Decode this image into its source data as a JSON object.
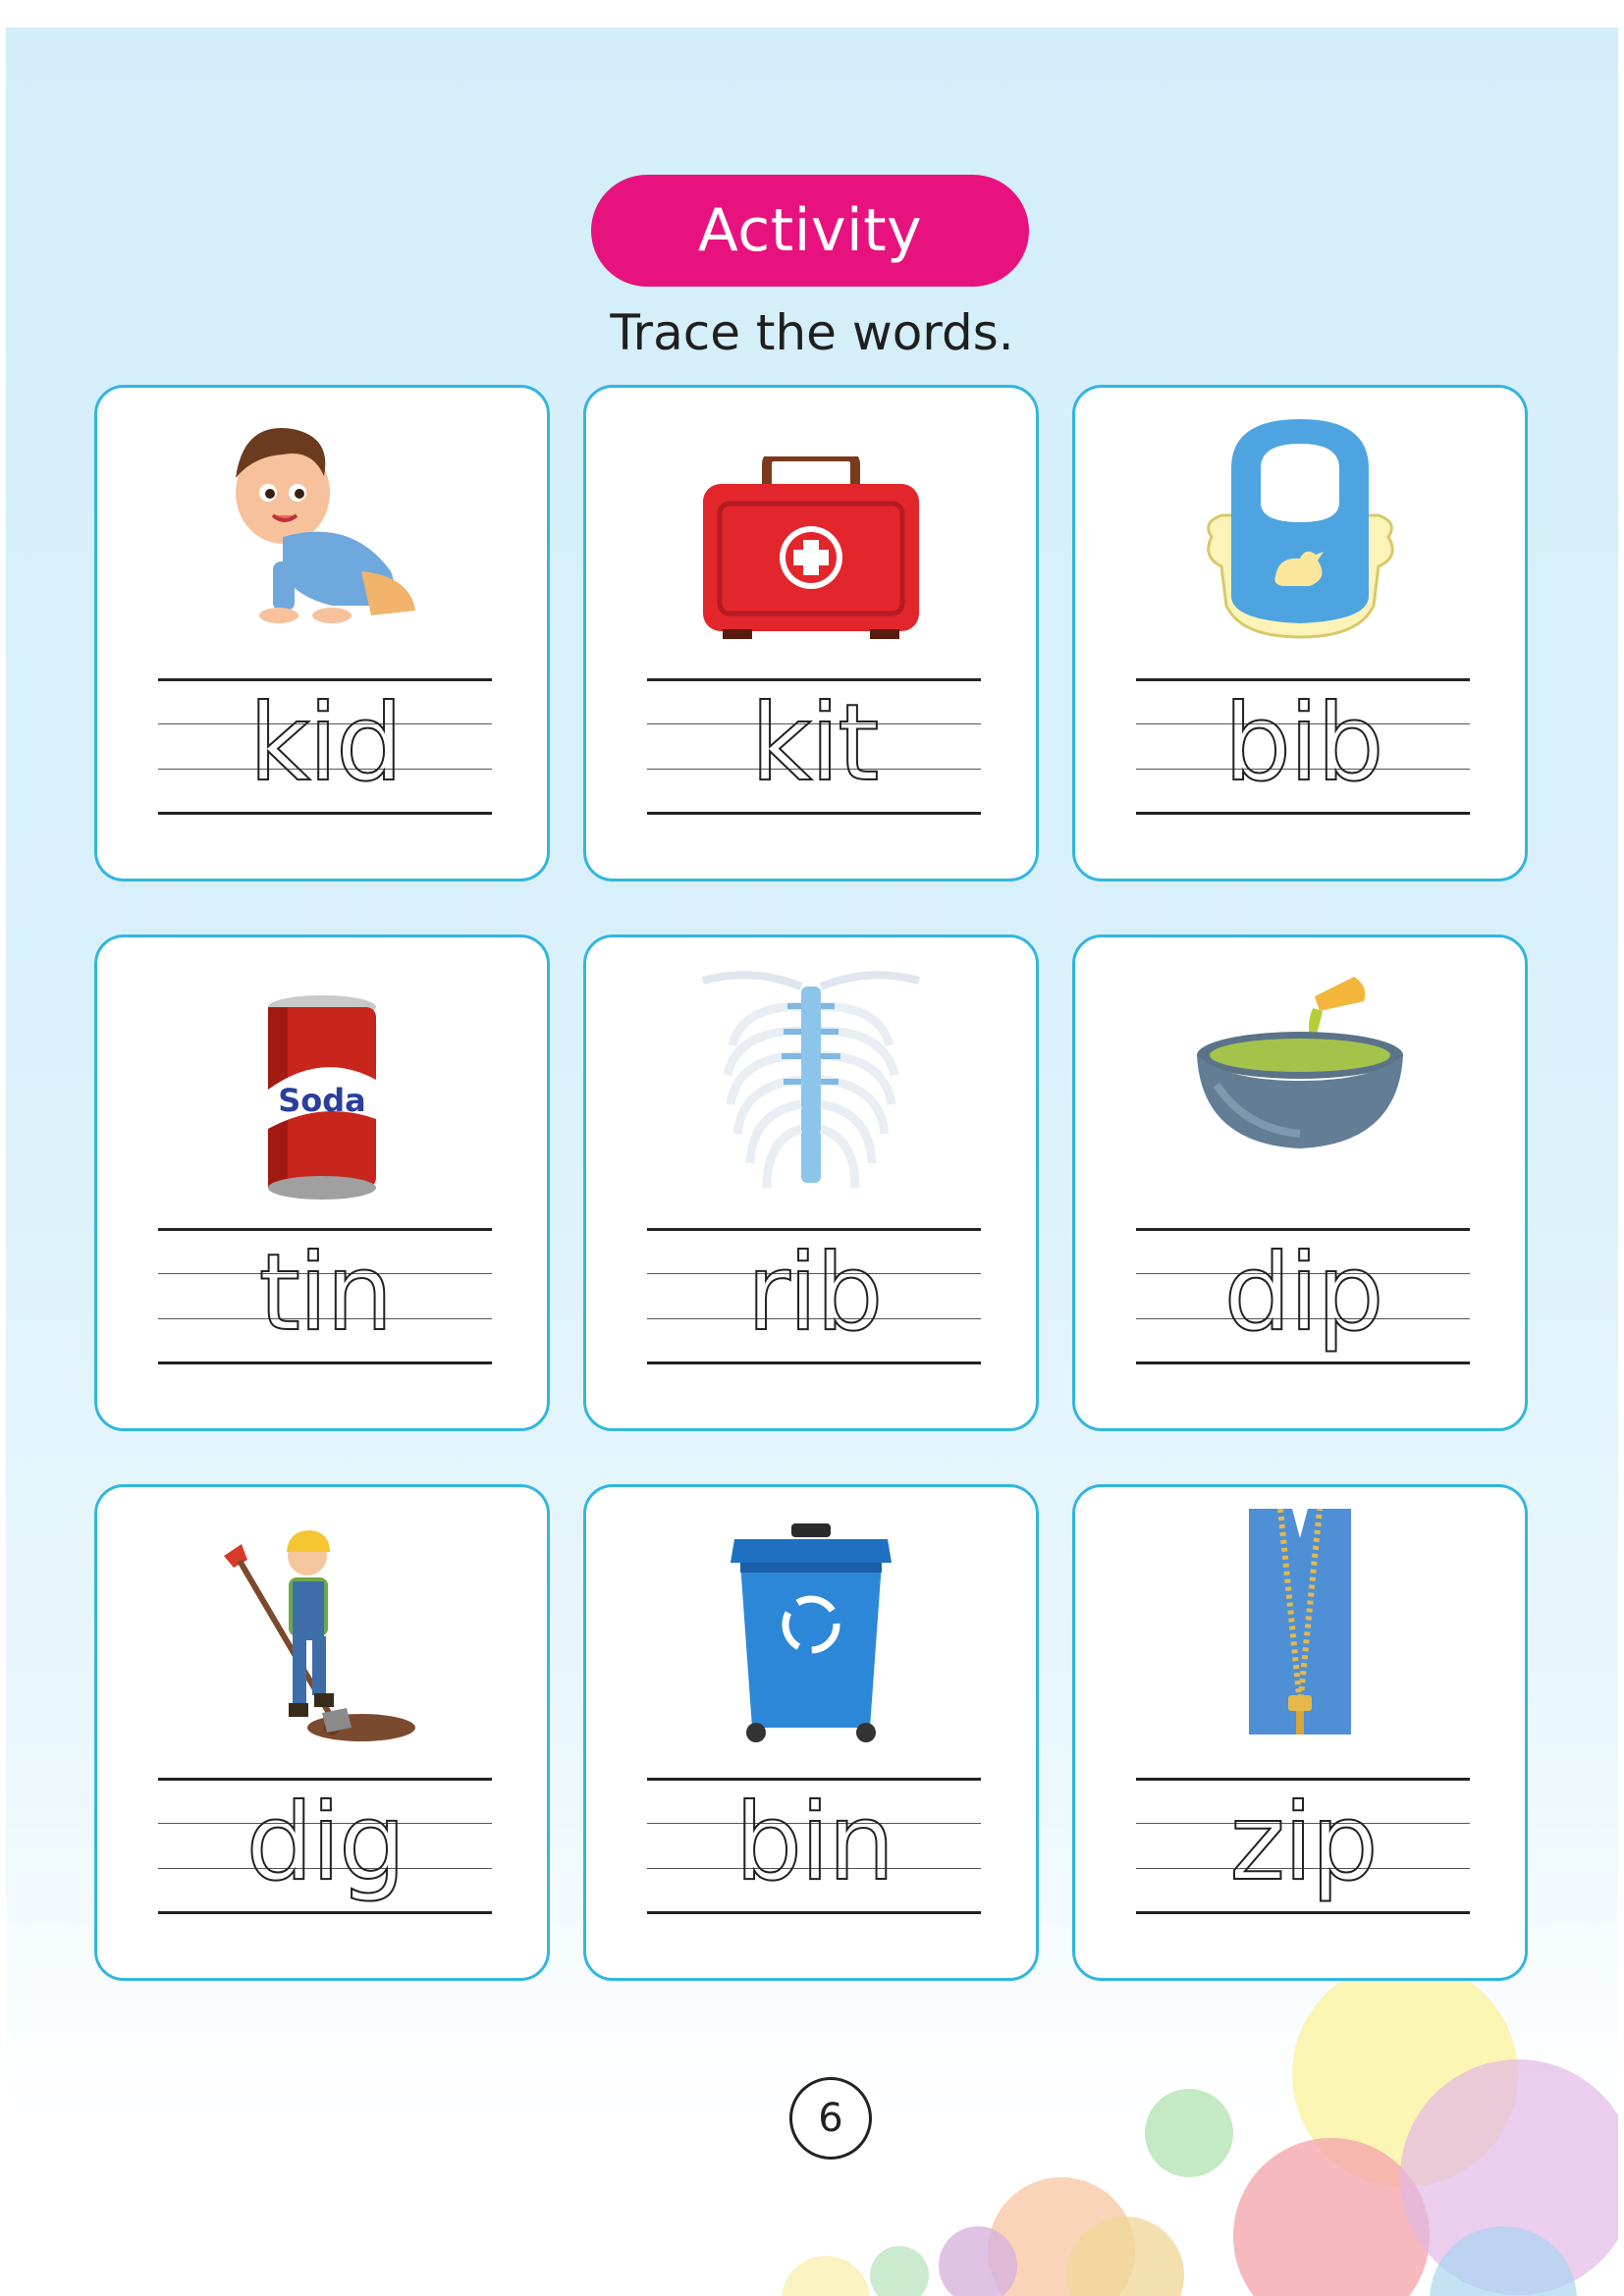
{
  "activity": {
    "badge_label": "Activity",
    "instruction": "Trace the words."
  },
  "cards": [
    {
      "word": "kid",
      "icon": "crawling-baby-icon"
    },
    {
      "word": "kit",
      "icon": "first-aid-kit-icon"
    },
    {
      "word": "bib",
      "icon": "baby-bib-icon"
    },
    {
      "word": "tin",
      "icon": "soda-can-icon",
      "image_text": "Soda"
    },
    {
      "word": "rib",
      "icon": "rib-cage-icon"
    },
    {
      "word": "dip",
      "icon": "dip-bowl-icon"
    },
    {
      "word": "dig",
      "icon": "boy-digging-icon"
    },
    {
      "word": "bin",
      "icon": "recycle-bin-icon"
    },
    {
      "word": "zip",
      "icon": "zipper-icon"
    }
  ],
  "page_number": "6",
  "colors": {
    "badge": "#e8127f",
    "card_border": "#32b6e0",
    "background_top": "#d3eefa"
  }
}
